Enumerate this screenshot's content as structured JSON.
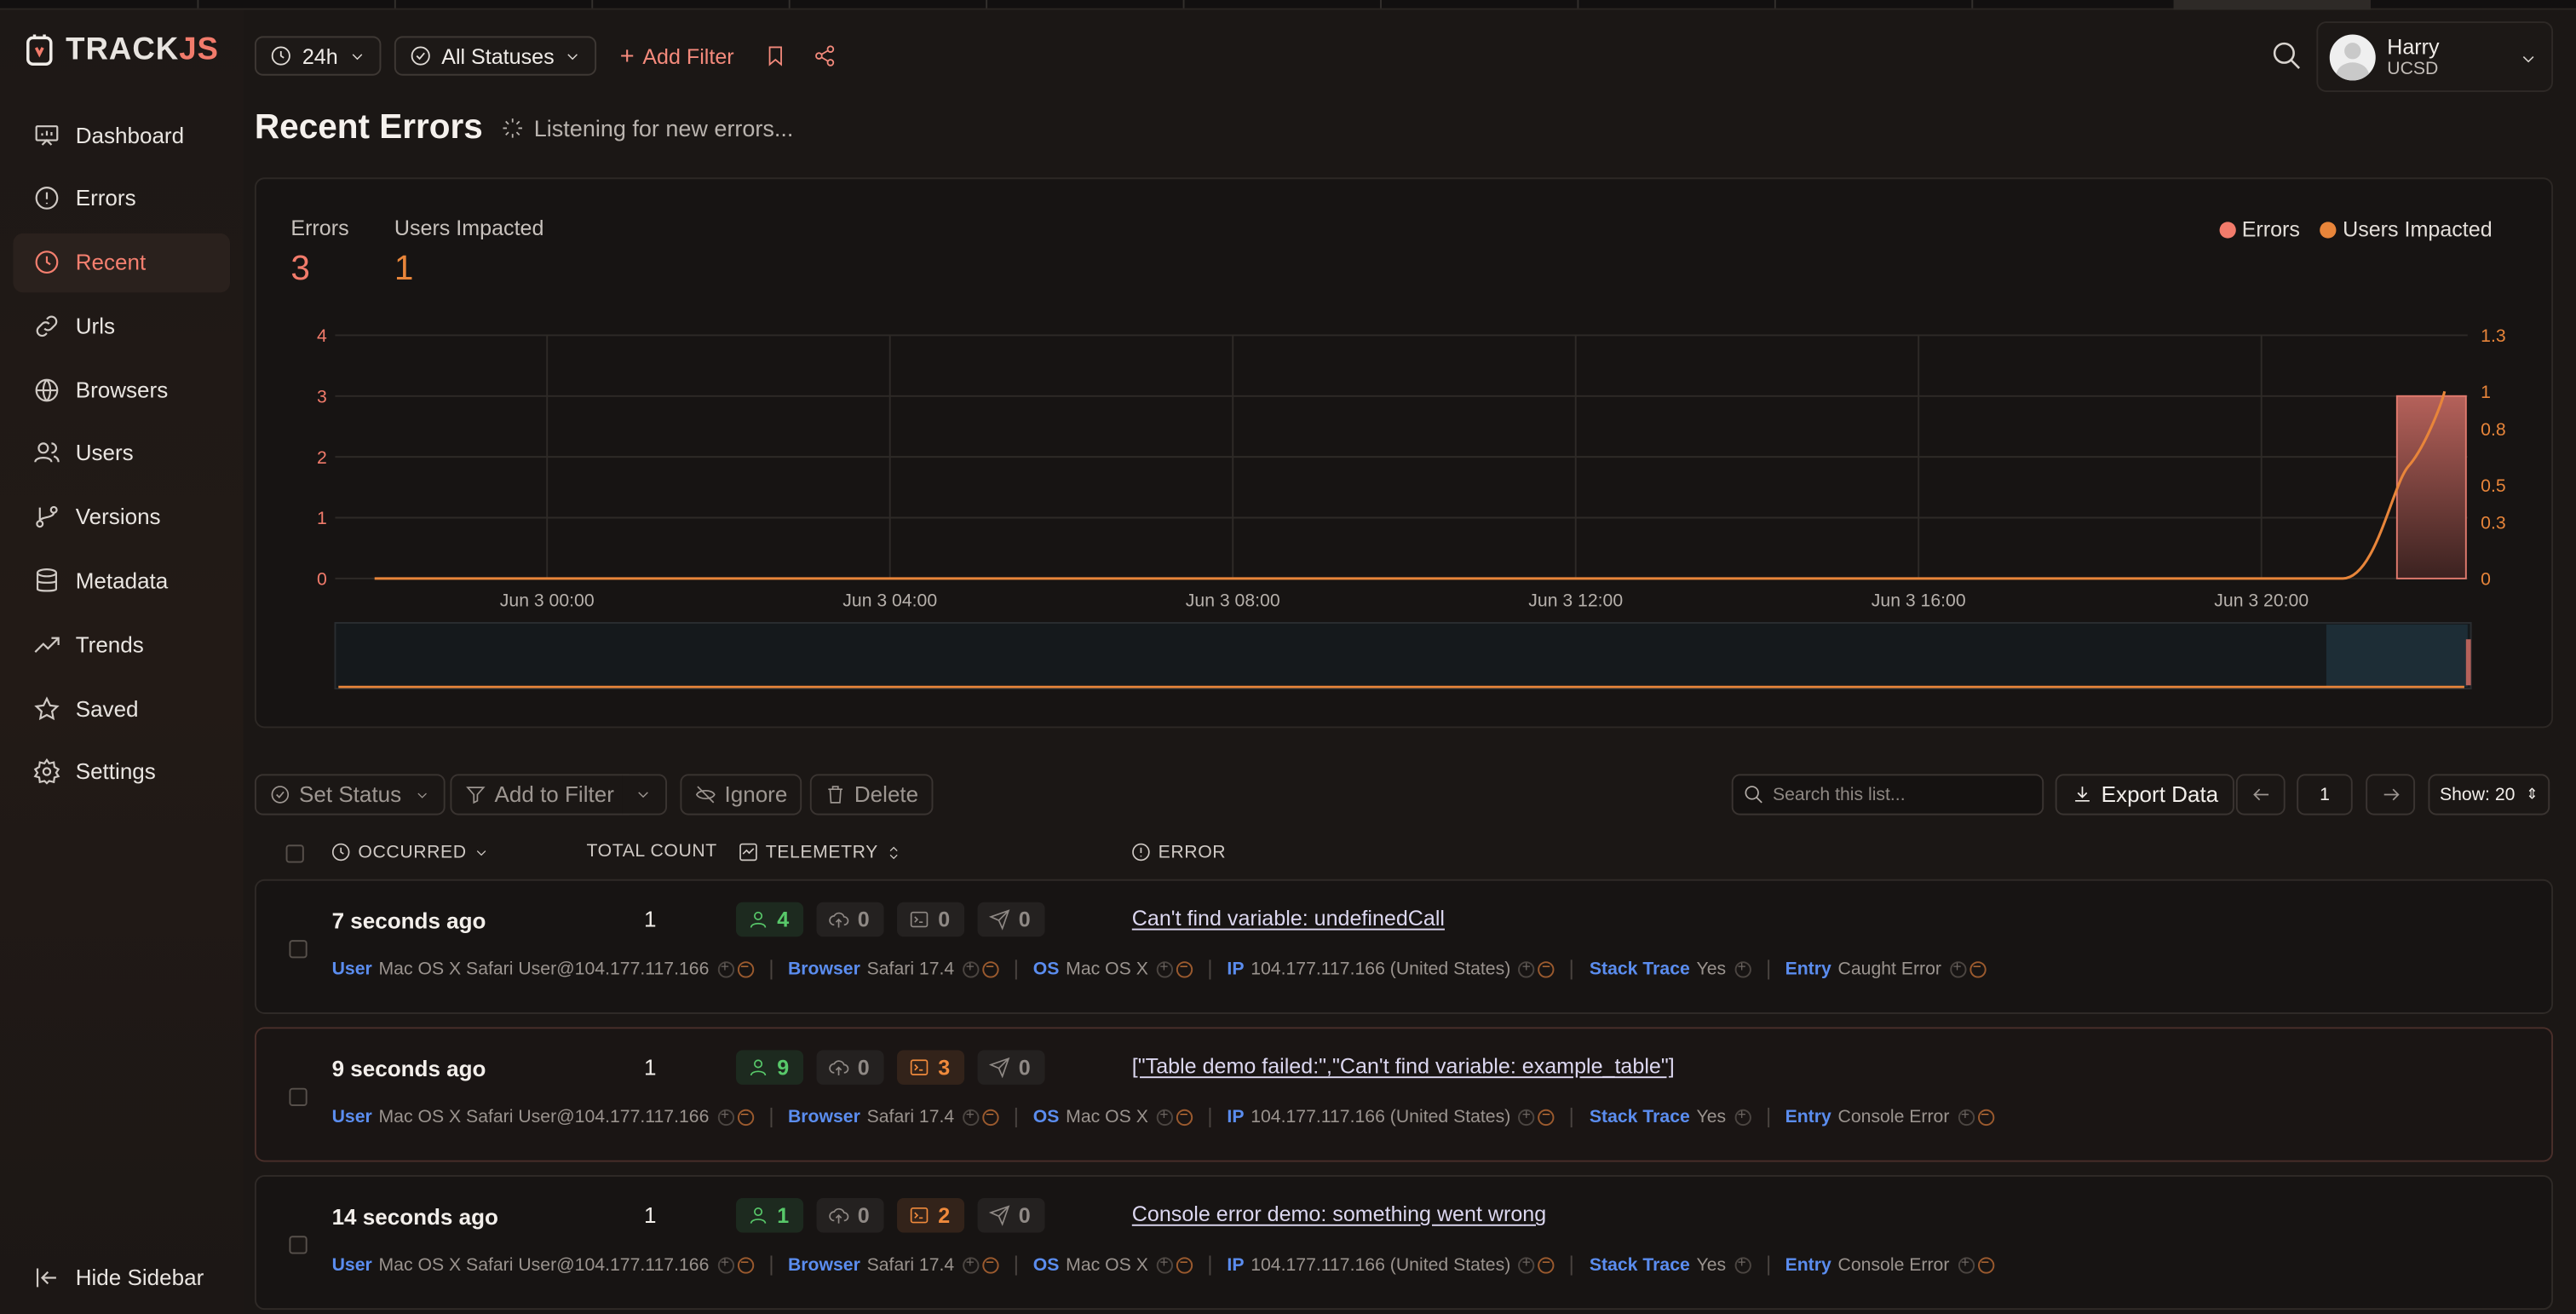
{
  "app": {
    "name_main": "TRACK",
    "name_js": "JS"
  },
  "sidebar": {
    "items": [
      {
        "label": "Dashboard",
        "icon": "dashboard-icon"
      },
      {
        "label": "Errors",
        "icon": "alert-circle-icon"
      },
      {
        "label": "Recent",
        "icon": "clock-icon",
        "active": true
      },
      {
        "label": "Urls",
        "icon": "link-icon"
      },
      {
        "label": "Browsers",
        "icon": "globe-icon"
      },
      {
        "label": "Users",
        "icon": "users-icon"
      },
      {
        "label": "Versions",
        "icon": "git-branch-icon"
      },
      {
        "label": "Metadata",
        "icon": "database-icon"
      },
      {
        "label": "Trends",
        "icon": "trending-up-icon"
      },
      {
        "label": "Saved",
        "icon": "star-icon"
      },
      {
        "label": "Settings",
        "icon": "gear-icon"
      }
    ],
    "hide_label": "Hide Sidebar"
  },
  "toolbar": {
    "time_range": "24h",
    "status": "All Statuses",
    "add_filter": "Add Filter"
  },
  "user": {
    "name": "Harry",
    "org": "UCSD"
  },
  "page": {
    "title": "Recent Errors",
    "listening": "Listening for new errors..."
  },
  "stats": {
    "errors_label": "Errors",
    "errors_value": "3",
    "users_label": "Users Impacted",
    "users_value": "1"
  },
  "colors": {
    "errors": "#f27b6b",
    "users": "#e8853a",
    "accent": "#f47f6f",
    "link": "#5b8def"
  },
  "chart_data": {
    "type": "bar",
    "legend": [
      "Errors",
      "Users Impacted"
    ],
    "legend_position": "top-right",
    "x_ticks": [
      "Jun 3 00:00",
      "Jun 3 04:00",
      "Jun 3 08:00",
      "Jun 3 12:00",
      "Jun 3 16:00",
      "Jun 3 20:00"
    ],
    "y_left_ticks": [
      "0",
      "1",
      "2",
      "3",
      "4"
    ],
    "y_right_ticks": [
      "0",
      "0.3",
      "0.5",
      "0.8",
      "1",
      "1.3"
    ],
    "ylim_left": [
      0,
      4
    ],
    "ylim_right": [
      0,
      1.3
    ],
    "series": [
      {
        "name": "Errors",
        "axis": "left",
        "bars": [
          {
            "bucket": "last",
            "value": 3
          }
        ]
      },
      {
        "name": "Users Impacted",
        "axis": "right",
        "line_end_value": 1
      }
    ],
    "grid": true
  },
  "list": {
    "set_status": "Set Status",
    "add_to_filter": "Add to Filter",
    "ignore": "Ignore",
    "delete": "Delete",
    "search_placeholder": "Search this list...",
    "export": "Export Data",
    "page": "1",
    "show": "Show: 20",
    "columns": {
      "occurred": "OCCURRED",
      "total": "TOTAL COUNT",
      "telemetry": "TELEMETRY",
      "error": "ERROR"
    }
  },
  "rows": [
    {
      "when": "7 seconds ago",
      "count": "1",
      "telemetry": {
        "users": "4",
        "network": "0",
        "console": "0",
        "navigation": "0"
      },
      "error": "Can't find variable: undefinedCall",
      "user": "Mac OS X Safari User@104.177.117.166",
      "browser": "Safari 17.4",
      "os": "Mac OS X",
      "ip": "104.177.117.166 (United States)",
      "stack": "Yes",
      "entry": "Caught Error"
    },
    {
      "when": "9 seconds ago",
      "count": "1",
      "telemetry": {
        "users": "9",
        "network": "0",
        "console": "3",
        "navigation": "0"
      },
      "error": "[\"Table demo failed:\",\"Can't find variable: example_table\"]",
      "user": "Mac OS X Safari User@104.177.117.166",
      "browser": "Safari 17.4",
      "os": "Mac OS X",
      "ip": "104.177.117.166 (United States)",
      "stack": "Yes",
      "entry": "Console Error"
    },
    {
      "when": "14 seconds ago",
      "count": "1",
      "telemetry": {
        "users": "1",
        "network": "0",
        "console": "2",
        "navigation": "0"
      },
      "error": "Console error demo: something went wrong",
      "user": "Mac OS X Safari User@104.177.117.166",
      "browser": "Safari 17.4",
      "os": "Mac OS X",
      "ip": "104.177.117.166 (United States)",
      "stack": "Yes",
      "entry": "Console Error"
    }
  ],
  "meta_keys": {
    "user": "User",
    "browser": "Browser",
    "os": "OS",
    "ip": "IP",
    "stack": "Stack Trace",
    "entry": "Entry"
  }
}
